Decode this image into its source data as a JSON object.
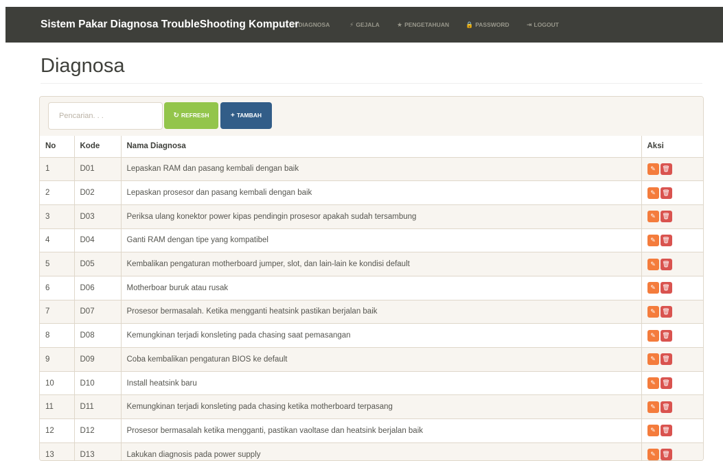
{
  "navbar": {
    "brand": "Sistem Pakar Diagnosa TroubleShooting Komputer",
    "items": [
      {
        "icon": "wrench-icon",
        "glyph": "↗",
        "label": "DIAGNOSA"
      },
      {
        "icon": "bolt-icon",
        "glyph": "⚡",
        "label": "GEJALA"
      },
      {
        "icon": "star-icon",
        "glyph": "★",
        "label": "PENGETAHUAN"
      },
      {
        "icon": "lock-icon",
        "glyph": "🔒",
        "label": "PASSWORD"
      },
      {
        "icon": "logout-icon",
        "glyph": "⇥",
        "label": "LOGOUT"
      }
    ]
  },
  "page": {
    "title": "Diagnosa"
  },
  "toolbar": {
    "search_placeholder": "Pencarian. . .",
    "refresh_label": "REFRESH",
    "refresh_icon": "refresh-icon",
    "tambah_label": "TAMBAH",
    "tambah_icon": "plus-icon"
  },
  "table": {
    "headers": {
      "no": "No",
      "kode": "Kode",
      "nama": "Nama Diagnosa",
      "aksi": "Aksi"
    },
    "rows": [
      {
        "no": "1",
        "kode": "D01",
        "nama": "Lepaskan RAM dan pasang kembali dengan baik"
      },
      {
        "no": "2",
        "kode": "D02",
        "nama": "Lepaskan prosesor dan pasang kembali dengan baik"
      },
      {
        "no": "3",
        "kode": "D03",
        "nama": "Periksa ulang konektor power kipas pendingin prosesor apakah sudah tersambung"
      },
      {
        "no": "4",
        "kode": "D04",
        "nama": "Ganti RAM dengan tipe yang kompatibel"
      },
      {
        "no": "5",
        "kode": "D05",
        "nama": "Kembalikan pengaturan motherboard jumper, slot, dan lain-lain ke kondisi default"
      },
      {
        "no": "6",
        "kode": "D06",
        "nama": "Motherboar buruk atau rusak"
      },
      {
        "no": "7",
        "kode": "D07",
        "nama": "Prosesor bermasalah. Ketika mengganti heatsink pastikan berjalan baik"
      },
      {
        "no": "8",
        "kode": "D08",
        "nama": "Kemungkinan terjadi konsleting pada chasing saat pemasangan"
      },
      {
        "no": "9",
        "kode": "D09",
        "nama": "Coba kembalikan pengaturan BIOS ke default"
      },
      {
        "no": "10",
        "kode": "D10",
        "nama": "Install heatsink baru"
      },
      {
        "no": "11",
        "kode": "D11",
        "nama": "Kemungkinan terjadi konsleting pada chasing ketika motherboard terpasang"
      },
      {
        "no": "12",
        "kode": "D12",
        "nama": "Prosesor bermasalah ketika mengganti, pastikan vaoltase dan heatsink berjalan baik"
      },
      {
        "no": "13",
        "kode": "D13",
        "nama": "Lakukan diagnosis pada power supply"
      }
    ],
    "actions": {
      "edit_icon": "edit-icon",
      "edit_glyph": "✎",
      "delete_icon": "trash-icon",
      "delete_glyph": "🗑"
    }
  },
  "colors": {
    "navbar_bg": "#3e3f3a",
    "refresh": "#93c54b",
    "tambah": "#325d88",
    "edit": "#f47c3c",
    "delete": "#d9534f",
    "stripe": "#f8f5f0"
  }
}
